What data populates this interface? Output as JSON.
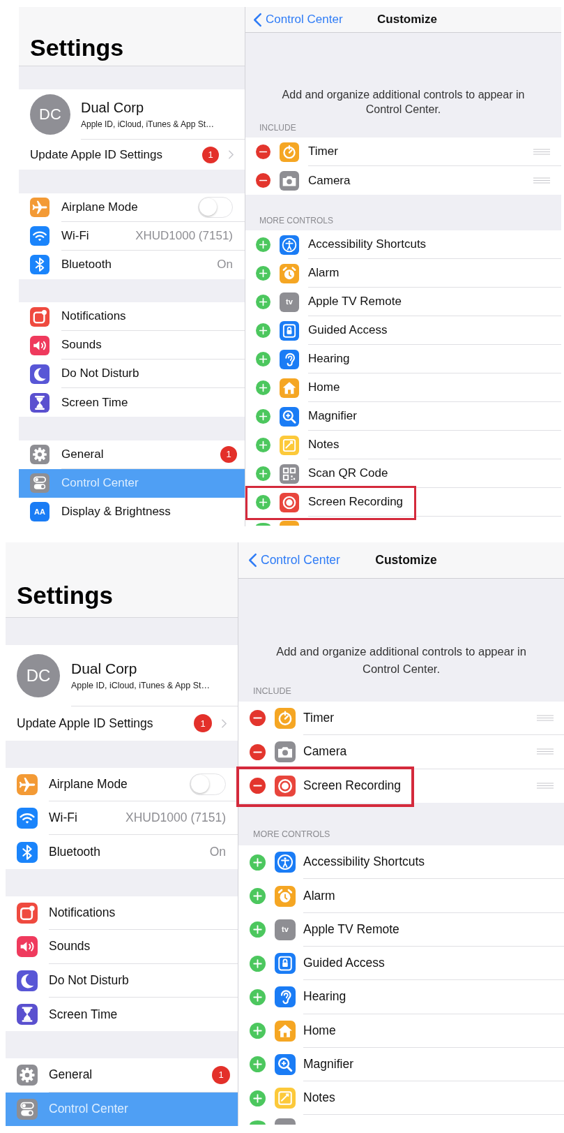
{
  "screens": [
    {
      "settings": {
        "title": "Settings",
        "account": {
          "initials": "DC",
          "name": "Dual Corp",
          "subtitle": "Apple ID, iCloud, iTunes & App St…"
        },
        "account_alert": {
          "label": "Update Apple ID Settings",
          "badge": "1"
        },
        "groups": [
          [
            {
              "label": "Airplane Mode",
              "kind": "toggle",
              "on": false,
              "selected": false
            },
            {
              "label": "Wi-Fi",
              "kind": "value",
              "value": "XHUD1000 (7151)",
              "selected": false
            },
            {
              "label": "Bluetooth",
              "kind": "value",
              "value": "On",
              "selected": false
            }
          ],
          [
            {
              "label": "Notifications",
              "kind": "plain",
              "selected": false
            },
            {
              "label": "Sounds",
              "kind": "plain",
              "selected": false
            },
            {
              "label": "Do Not Disturb",
              "kind": "plain",
              "selected": false
            },
            {
              "label": "Screen Time",
              "kind": "plain",
              "selected": false
            }
          ],
          [
            {
              "label": "General",
              "kind": "badge",
              "badge": "1",
              "selected": false
            },
            {
              "label": "Control Center",
              "kind": "plain",
              "selected": true
            },
            {
              "label": "Display & Brightness",
              "kind": "plain",
              "icon_text": "AA",
              "selected": false
            }
          ]
        ]
      },
      "customize": {
        "back": "Control Center",
        "title": "Customize",
        "description": "Add and organize additional controls to appear in Control Center.",
        "sections": [
          {
            "header": "INCLUDE",
            "items": [
              {
                "label": "Timer",
                "included": true,
                "highlighted": false
              },
              {
                "label": "Camera",
                "included": true,
                "highlighted": false
              }
            ]
          },
          {
            "header": "MORE CONTROLS",
            "items": [
              {
                "label": "Accessibility Shortcuts",
                "included": false,
                "highlighted": false
              },
              {
                "label": "Alarm",
                "included": false,
                "highlighted": false
              },
              {
                "label": "Apple TV Remote",
                "icon_text": "tv",
                "included": false,
                "highlighted": false
              },
              {
                "label": "Guided Access",
                "included": false,
                "highlighted": false
              },
              {
                "label": "Hearing",
                "included": false,
                "highlighted": false
              },
              {
                "label": "Home",
                "included": false,
                "highlighted": false
              },
              {
                "label": "Magnifier",
                "included": false,
                "highlighted": false
              },
              {
                "label": "Notes",
                "included": false,
                "highlighted": false
              },
              {
                "label": "Scan QR Code",
                "included": false,
                "highlighted": false
              },
              {
                "label": "Screen Recording",
                "included": false,
                "highlighted": true
              },
              {
                "cut_off": true,
                "included": false
              }
            ]
          }
        ]
      }
    },
    {
      "settings": {
        "title": "Settings",
        "account": {
          "initials": "DC",
          "name": "Dual Corp",
          "subtitle": "Apple ID, iCloud, iTunes & App St…"
        },
        "account_alert": {
          "label": "Update Apple ID Settings",
          "badge": "1"
        },
        "groups": [
          [
            {
              "label": "Airplane Mode",
              "kind": "toggle",
              "on": false,
              "selected": false
            },
            {
              "label": "Wi-Fi",
              "kind": "value",
              "value": "XHUD1000 (7151)",
              "selected": false
            },
            {
              "label": "Bluetooth",
              "kind": "value",
              "value": "On",
              "selected": false
            }
          ],
          [
            {
              "label": "Notifications",
              "kind": "plain",
              "selected": false
            },
            {
              "label": "Sounds",
              "kind": "plain",
              "selected": false
            },
            {
              "label": "Do Not Disturb",
              "kind": "plain",
              "selected": false
            },
            {
              "label": "Screen Time",
              "kind": "plain",
              "selected": false
            }
          ],
          [
            {
              "label": "General",
              "kind": "badge",
              "badge": "1",
              "selected": false
            },
            {
              "label": "Control Center",
              "kind": "plain",
              "selected": true
            }
          ]
        ]
      },
      "customize": {
        "back": "Control Center",
        "title": "Customize",
        "description": "Add and organize additional controls to appear in Control Center.",
        "sections": [
          {
            "header": "INCLUDE",
            "items": [
              {
                "label": "Timer",
                "included": true,
                "highlighted": false
              },
              {
                "label": "Camera",
                "included": true,
                "highlighted": false
              },
              {
                "label": "Screen Recording",
                "included": true,
                "highlighted": true
              }
            ]
          },
          {
            "header": "MORE CONTROLS",
            "items": [
              {
                "label": "Accessibility Shortcuts",
                "included": false,
                "highlighted": false
              },
              {
                "label": "Alarm",
                "included": false,
                "highlighted": false
              },
              {
                "label": "Apple TV Remote",
                "icon_text": "tv",
                "included": false,
                "highlighted": false
              },
              {
                "label": "Guided Access",
                "included": false,
                "highlighted": false
              },
              {
                "label": "Hearing",
                "included": false,
                "highlighted": false
              },
              {
                "label": "Home",
                "included": false,
                "highlighted": false
              },
              {
                "label": "Magnifier",
                "included": false,
                "highlighted": false
              },
              {
                "label": "Notes",
                "included": false,
                "highlighted": false
              },
              {
                "cut_off": true,
                "included": false
              }
            ]
          }
        ]
      }
    }
  ]
}
